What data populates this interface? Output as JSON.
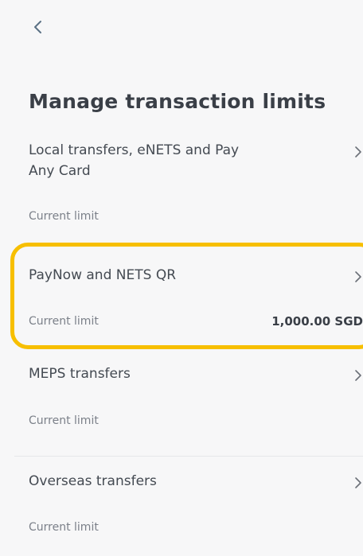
{
  "header": {
    "back_icon": "chevron-left-icon",
    "title": "Manage transaction limits"
  },
  "limits": [
    {
      "name": "Local transfers, eNETS and Pay Any Card",
      "label": "Current limit",
      "value": ""
    },
    {
      "name": "PayNow and NETS QR",
      "label": "Current limit",
      "value": "1,000.00 SGD"
    },
    {
      "name": "MEPS transfers",
      "label": "Current limit",
      "value": ""
    },
    {
      "name": "Overseas transfers",
      "label": "Current limit",
      "value": ""
    }
  ],
  "colors": {
    "highlight": "#f7bf00",
    "background": "#f7f7f8",
    "text": "#3a3f47"
  }
}
